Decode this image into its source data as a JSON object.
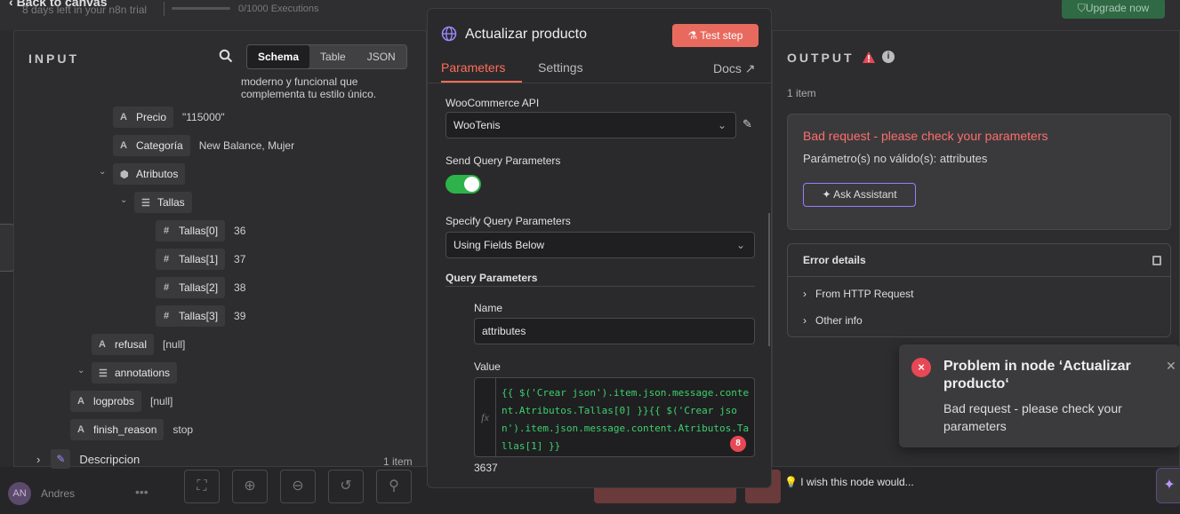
{
  "topbar": {
    "back_label": "Back to canvas",
    "trial_text": "8 days left in your n8n trial",
    "executions": "0/1000 Executions",
    "upgrade_label": "Upgrade now"
  },
  "input": {
    "title": "INPUT",
    "view_tabs": [
      "Schema",
      "Table",
      "JSON"
    ],
    "active_view": "Schema",
    "cut_text": "moderno y funcional que complementa tu estilo único.",
    "fields": [
      {
        "type": "A",
        "name": "Precio",
        "value": "\"115000\""
      },
      {
        "type": "A",
        "name": "Categoría",
        "value": "New Balance, Mujer"
      },
      {
        "type": "obj",
        "name": "Atributos",
        "value": ""
      },
      {
        "type": "list",
        "name": "Tallas",
        "value": ""
      },
      {
        "type": "#",
        "name": "Tallas[0]",
        "value": "36"
      },
      {
        "type": "#",
        "name": "Tallas[1]",
        "value": "37"
      },
      {
        "type": "#",
        "name": "Tallas[2]",
        "value": "38"
      },
      {
        "type": "#",
        "name": "Tallas[3]",
        "value": "39"
      },
      {
        "type": "A",
        "name": "refusal",
        "value": "[null]"
      },
      {
        "type": "list",
        "name": "annotations",
        "value": ""
      },
      {
        "type": "A",
        "name": "logprobs",
        "value": "[null]"
      },
      {
        "type": "A",
        "name": "finish_reason",
        "value": "stop"
      }
    ],
    "desc_node": "Descripcion",
    "item_count": "1 item"
  },
  "node": {
    "title": "Actualizar producto",
    "test_step_label": "Test step",
    "tabs": [
      "Parameters",
      "Settings"
    ],
    "docs_label": "Docs",
    "credential_label": "WooCommerce API",
    "credential_value": "WooTenis",
    "send_query_label": "Send Query Parameters",
    "send_query_enabled": true,
    "specify_label": "Specify Query Parameters",
    "specify_value": "Using Fields Below",
    "query_params_label": "Query Parameters",
    "name_label": "Name",
    "name_value": "attributes",
    "value_label": "Value",
    "value_expr": "{{ $('Crear json').item.json.message.content.Atributos.Tallas[0] }}{{ $('Crear json').item.json.message.content.Atributos.Tallas[1] }}",
    "issue_count": "8",
    "result": "3637"
  },
  "output": {
    "title": "OUTPUT",
    "items": "1 item",
    "error_title": "Bad request - please check your parameters",
    "error_message": "Parámetro(s) no válido(s): attributes",
    "ask_label": "Ask Assistant",
    "details_title": "Error details",
    "details_items": [
      "From HTTP Request",
      "Other info"
    ]
  },
  "toast": {
    "title": "Problem in node ‘Actualizar producto‘",
    "message": "Bad request - please check your parameters"
  },
  "footer": {
    "avatar_initials": "AN",
    "user_name": "Andres",
    "wish_text": "I wish this node would..."
  },
  "colors": {
    "accent": "#ff6d5a",
    "error": "#e84855",
    "toggle_on": "#2db34a",
    "assistant": "#9a7cff"
  }
}
